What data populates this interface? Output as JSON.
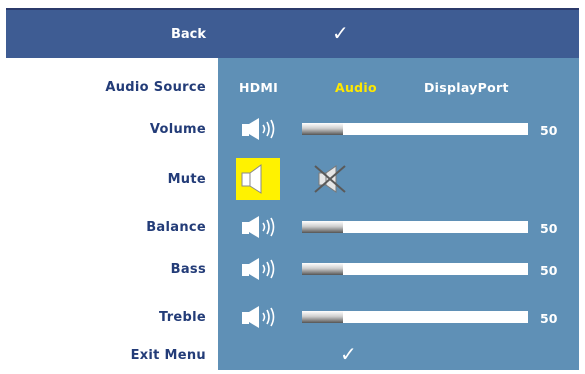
{
  "header": {
    "back_label": "Back"
  },
  "menu": {
    "audio_source": {
      "label": "Audio Source",
      "options": [
        {
          "label": "HDMI",
          "selected": false
        },
        {
          "label": "Audio",
          "selected": true
        },
        {
          "label": "DisplayPort",
          "selected": false
        }
      ]
    },
    "volume": {
      "label": "Volume",
      "value": "50",
      "level": 0.18
    },
    "mute": {
      "label": "Mute",
      "selected_option": "unmuted"
    },
    "balance": {
      "label": "Balance",
      "value": "50",
      "level": 0.18
    },
    "bass": {
      "label": "Bass",
      "value": "50",
      "level": 0.18
    },
    "treble": {
      "label": "Treble",
      "value": "50",
      "level": 0.18
    },
    "exit": {
      "label": "Exit Menu"
    }
  },
  "colors": {
    "header_bg": "#3e5c93",
    "panel_bg": "#5f90b6",
    "label_text": "#233c78",
    "selected_text": "#ffe800",
    "highlight": "#fff200"
  },
  "icons": {
    "confirm": "checkmark-icon",
    "speaker": "speaker-icon",
    "mute": "muted-speaker-icon"
  }
}
